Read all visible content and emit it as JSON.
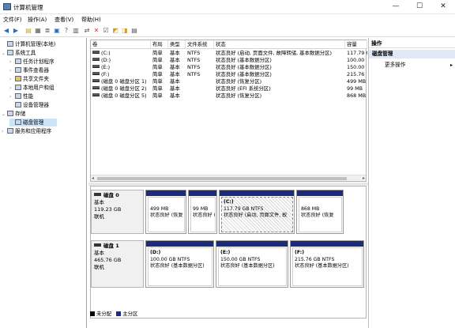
{
  "window": {
    "title": "计算机管理"
  },
  "menu": [
    "文件(F)",
    "操作(A)",
    "查看(V)",
    "帮助(H)"
  ],
  "tree": [
    {
      "label": "计算机管理(本地)",
      "depth": 0,
      "arrow": ""
    },
    {
      "label": "系统工具",
      "depth": 1,
      "arrow": "⌄"
    },
    {
      "label": "任务计划程序",
      "depth": 2,
      "arrow": "›"
    },
    {
      "label": "事件查看器",
      "depth": 2,
      "arrow": "›"
    },
    {
      "label": "共享文件夹",
      "depth": 2,
      "arrow": "›"
    },
    {
      "label": "本地用户和组",
      "depth": 2,
      "arrow": "›"
    },
    {
      "label": "性能",
      "depth": 2,
      "arrow": "›"
    },
    {
      "label": "设备管理器",
      "depth": 2,
      "arrow": ""
    },
    {
      "label": "存储",
      "depth": 1,
      "arrow": "⌄"
    },
    {
      "label": "磁盘管理",
      "depth": 2,
      "arrow": "",
      "selected": true
    },
    {
      "label": "服务和应用程序",
      "depth": 1,
      "arrow": "›"
    }
  ],
  "volume_columns": [
    "卷",
    "布局",
    "类型",
    "文件系统",
    "状态",
    "容量"
  ],
  "volumes": [
    {
      "name": "(C:)",
      "layout": "简单",
      "type": "基本",
      "fs": "NTFS",
      "status": "状态良好 (启动, 页面文件, 故障转储, 基本数据分区)",
      "capacity": "117.79 G"
    },
    {
      "name": "(D:)",
      "layout": "简单",
      "type": "基本",
      "fs": "NTFS",
      "status": "状态良好 (基本数据分区)",
      "capacity": "100.00"
    },
    {
      "name": "(E:)",
      "layout": "简单",
      "type": "基本",
      "fs": "NTFS",
      "status": "状态良好 (基本数据分区)",
      "capacity": "150.00"
    },
    {
      "name": "(F:)",
      "layout": "简单",
      "type": "基本",
      "fs": "NTFS",
      "status": "状态良好 (基本数据分区)",
      "capacity": "215.76"
    },
    {
      "name": "(磁盘 0 磁盘分区 1)",
      "layout": "简单",
      "type": "基本",
      "fs": "",
      "status": "状态良好 (恢复分区)",
      "capacity": "499 MB"
    },
    {
      "name": "(磁盘 0 磁盘分区 2)",
      "layout": "简单",
      "type": "基本",
      "fs": "",
      "status": "状态良好 (EFI 系统分区)",
      "capacity": "99 MB"
    },
    {
      "name": "(磁盘 0 磁盘分区 5)",
      "layout": "简单",
      "type": "基本",
      "fs": "",
      "status": "状态良好 (恢复分区)",
      "capacity": "868 MB"
    }
  ],
  "disks": [
    {
      "title": "磁盘 0",
      "kind": "基本",
      "size": "119.23 GB",
      "state": "联机",
      "partitions": [
        {
          "line1": "",
          "line2": "499 MB",
          "line3": "状态良好 (恢复"
        },
        {
          "line1": "",
          "line2": "99 MB",
          "line3": "状态良好 (EF"
        },
        {
          "line1": "(C:)",
          "line2": "117.79 GB NTFS",
          "line3": "状态良好 (启动, 页面文件, 故"
        },
        {
          "line1": "",
          "line2": "868 MB",
          "line3": "状态良好 (恢复"
        }
      ]
    },
    {
      "title": "磁盘 1",
      "kind": "基本",
      "size": "465.76 GB",
      "state": "联机",
      "partitions": [
        {
          "line1": "(D:)",
          "line2": "100.00 GB NTFS",
          "line3": "状态良好 (基本数据分区)"
        },
        {
          "line1": "(E:)",
          "line2": "150.00 GB NTFS",
          "line3": "状态良好 (基本数据分区)"
        },
        {
          "line1": "(F:)",
          "line2": "215.76 GB NTFS",
          "line3": "状态良好 (基本数据分区)"
        }
      ]
    }
  ],
  "legend": [
    {
      "label": "未分配",
      "color": "#000000"
    },
    {
      "label": "主分区",
      "color": "#1c2a7a"
    }
  ],
  "actions": {
    "header": "操作",
    "section": "磁盘管理",
    "more": "更多操作"
  },
  "colors": {
    "partition_bar": "#1c2a7a",
    "selected": "#cce4f7"
  }
}
